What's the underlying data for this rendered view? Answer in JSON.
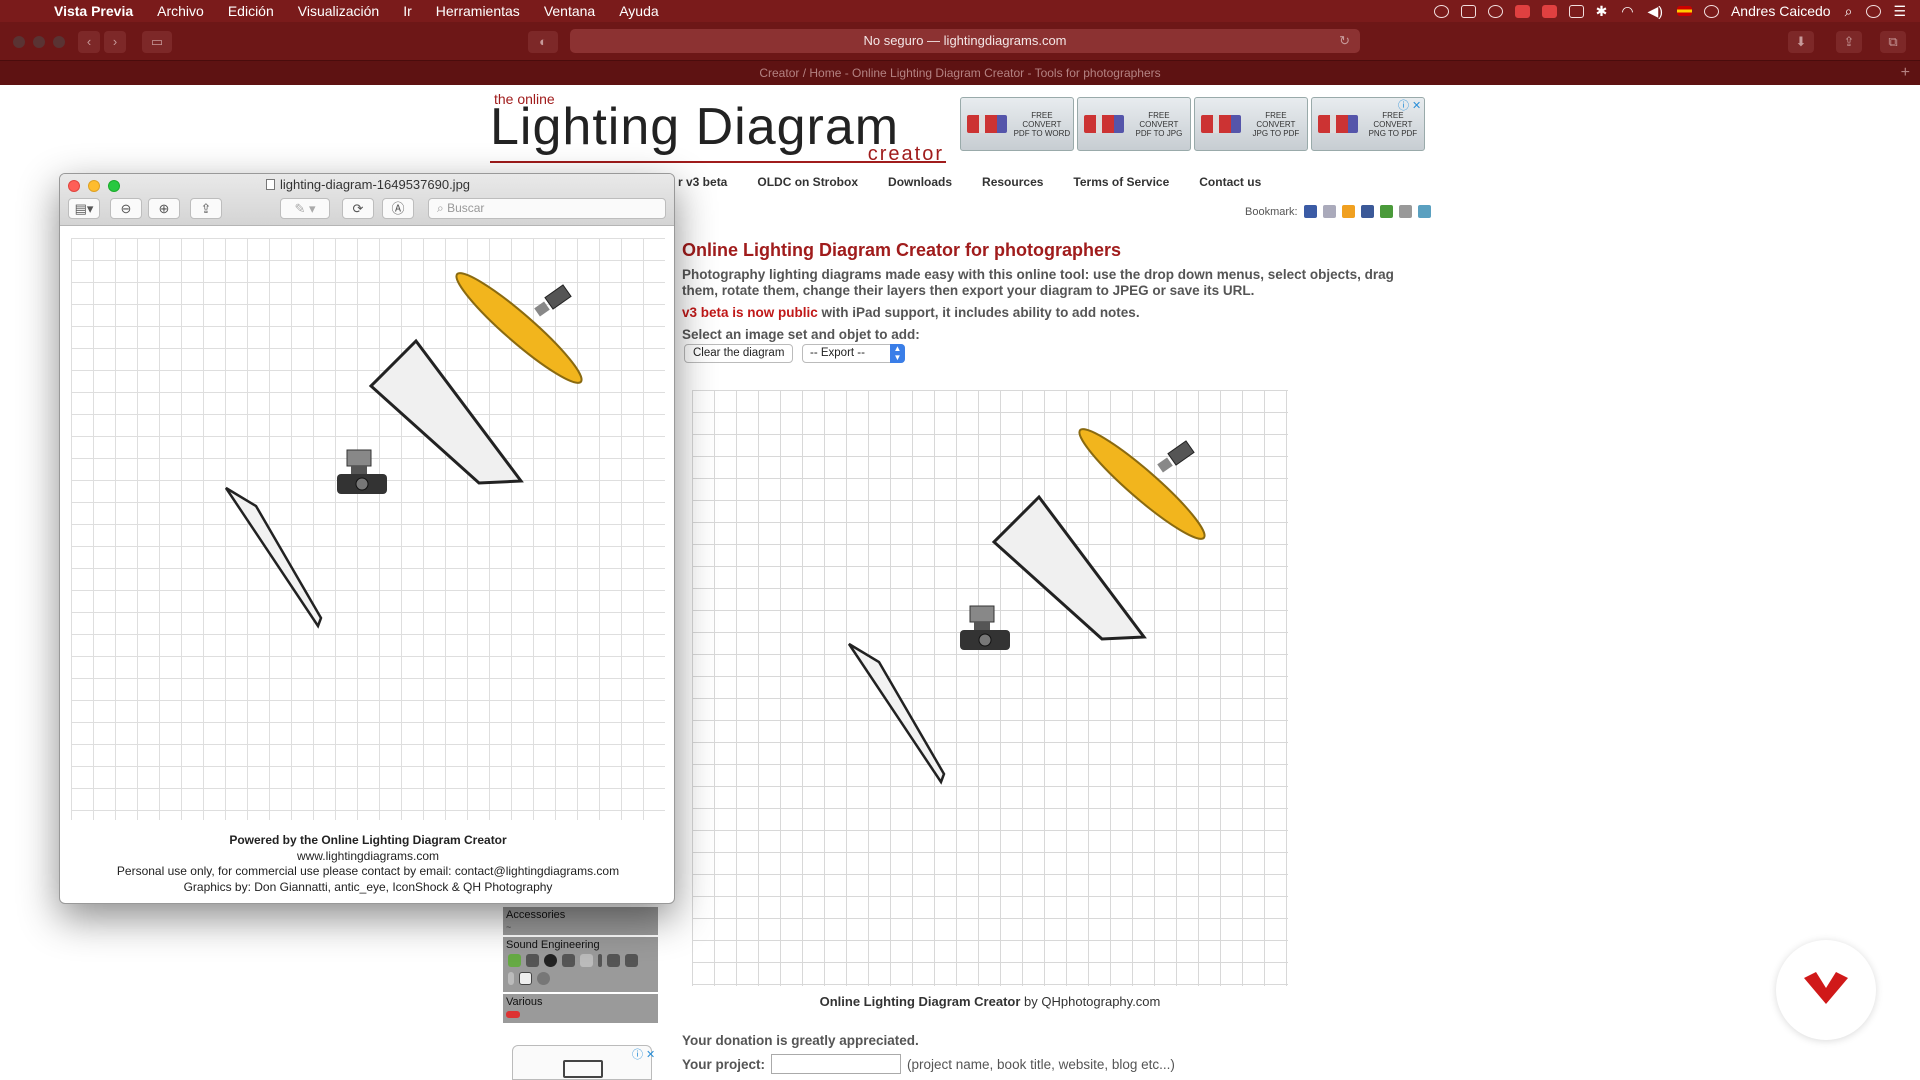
{
  "menubar": {
    "app_name": "Vista Previa",
    "menus": [
      "Archivo",
      "Edición",
      "Visualización",
      "Ir",
      "Herramientas",
      "Ventana",
      "Ayuda"
    ],
    "user": "Andres Caicedo"
  },
  "browser": {
    "address": "No seguro — lightingdiagrams.com",
    "tab_title": "Creator / Home - Online Lighting Diagram Creator - Tools for photographers"
  },
  "site": {
    "logo_small": "the online",
    "logo_big": "Lighting Diagram",
    "logo_sub": "creator",
    "ads": [
      {
        "line1": "FREE CONVERT",
        "line2": "PDF TO WORD"
      },
      {
        "line1": "FREE CONVERT",
        "line2": "PDF TO JPG"
      },
      {
        "line1": "FREE CONVERT",
        "line2": "JPG TO PDF"
      },
      {
        "line1": "FREE CONVERT",
        "line2": "PNG TO PDF"
      }
    ],
    "nav": [
      "r v3 beta",
      "OLDC on Strobox",
      "Downloads",
      "Resources",
      "Terms of Service",
      "Contact us"
    ],
    "bookmark_label": "Bookmark:",
    "title": "Online Lighting Diagram Creator for photographers",
    "description": "Photography lighting diagrams made easy with this online tool: use the drop down menus, select objects, drag them, rotate them, change their layers then export your diagram to JPEG or save its URL.",
    "beta_highlight": "v3 beta is now public",
    "beta_rest": "with iPad support, it includes ability to add notes.",
    "select_label": "Select an image set and objet to add:",
    "clear_button": "Clear the diagram",
    "export_select": "-- Export --",
    "creator_caption_bold": "Online Lighting Diagram Creator",
    "creator_caption_rest": "by QHphotography.com",
    "donation": "Your donation is greatly appreciated.",
    "project_label": "Your project:",
    "project_hint": "(project name, book title, website, blog etc...)",
    "panel": {
      "accessories": "Accessories",
      "sound": "Sound Engineering",
      "various": "Various"
    }
  },
  "preview": {
    "filename": "lighting-diagram-1649537690.jpg",
    "search_placeholder": "Buscar",
    "footer": {
      "line1": "Powered by the Online Lighting Diagram Creator",
      "line2": "www.lightingdiagrams.com",
      "line3": "Personal use only, for commercial use please contact by email: contact@lightingdiagrams.com",
      "line4": "Graphics by: Don Giannatti, antic_eye, IconShock & QH Photography"
    }
  },
  "colors": {
    "menubar": "#7a1b1b",
    "accent_red": "#a01c1c",
    "reflector_yellow": "#f2b51d"
  }
}
